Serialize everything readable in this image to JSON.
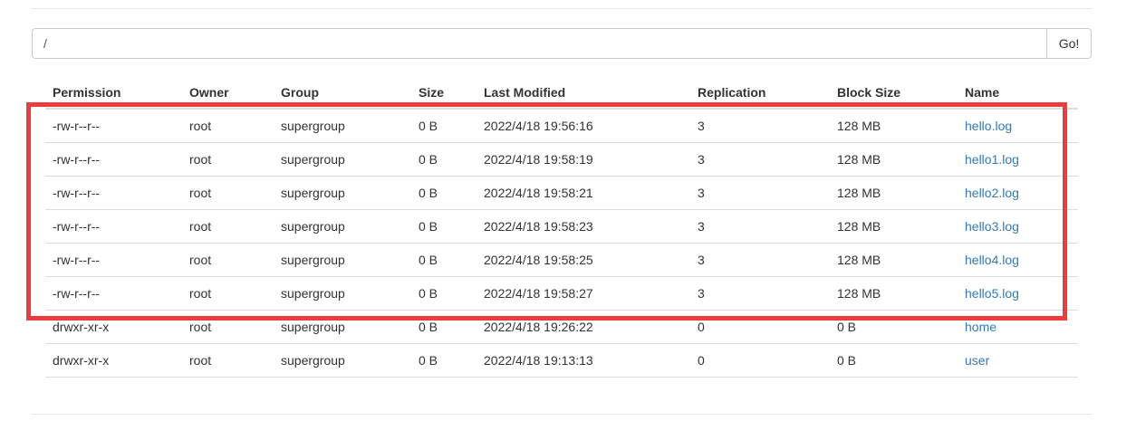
{
  "path_bar": {
    "value": "/",
    "go_label": "Go!"
  },
  "table": {
    "headers": [
      "Permission",
      "Owner",
      "Group",
      "Size",
      "Last Modified",
      "Replication",
      "Block Size",
      "Name"
    ],
    "rows": [
      {
        "permission": "-rw-r--r--",
        "owner": "root",
        "group": "supergroup",
        "size": "0 B",
        "last_modified": "2022/4/18 19:56:16",
        "replication": "3",
        "block_size": "128 MB",
        "name": "hello.log"
      },
      {
        "permission": "-rw-r--r--",
        "owner": "root",
        "group": "supergroup",
        "size": "0 B",
        "last_modified": "2022/4/18 19:58:19",
        "replication": "3",
        "block_size": "128 MB",
        "name": "hello1.log"
      },
      {
        "permission": "-rw-r--r--",
        "owner": "root",
        "group": "supergroup",
        "size": "0 B",
        "last_modified": "2022/4/18 19:58:21",
        "replication": "3",
        "block_size": "128 MB",
        "name": "hello2.log"
      },
      {
        "permission": "-rw-r--r--",
        "owner": "root",
        "group": "supergroup",
        "size": "0 B",
        "last_modified": "2022/4/18 19:58:23",
        "replication": "3",
        "block_size": "128 MB",
        "name": "hello3.log"
      },
      {
        "permission": "-rw-r--r--",
        "owner": "root",
        "group": "supergroup",
        "size": "0 B",
        "last_modified": "2022/4/18 19:58:25",
        "replication": "3",
        "block_size": "128 MB",
        "name": "hello4.log"
      },
      {
        "permission": "-rw-r--r--",
        "owner": "root",
        "group": "supergroup",
        "size": "0 B",
        "last_modified": "2022/4/18 19:58:27",
        "replication": "3",
        "block_size": "128 MB",
        "name": "hello5.log"
      },
      {
        "permission": "drwxr-xr-x",
        "owner": "root",
        "group": "supergroup",
        "size": "0 B",
        "last_modified": "2022/4/18 19:26:22",
        "replication": "0",
        "block_size": "0 B",
        "name": "home"
      },
      {
        "permission": "drwxr-xr-x",
        "owner": "root",
        "group": "supergroup",
        "size": "0 B",
        "last_modified": "2022/4/18 19:13:13",
        "replication": "0",
        "block_size": "0 B",
        "name": "user"
      }
    ]
  },
  "colors": {
    "link": "#337ab7",
    "highlight": "#ee3b3b",
    "border": "#dddddd"
  }
}
